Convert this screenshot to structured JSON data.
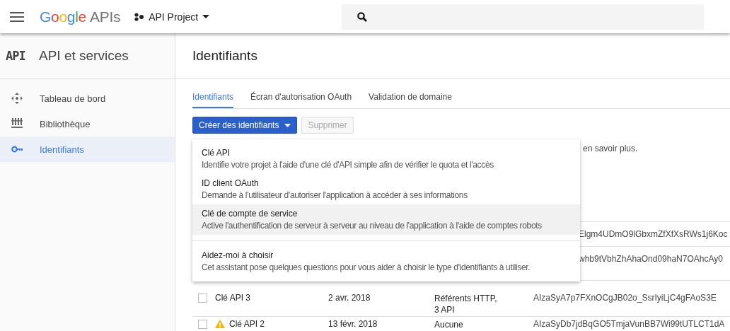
{
  "header": {
    "logo": {
      "brand": "Google",
      "product": "APIs"
    },
    "project": "API Project"
  },
  "sidebar": {
    "badge": "API",
    "title": "API et services",
    "items": [
      {
        "label": "Tableau de bord",
        "selected": false
      },
      {
        "label": "Bibliothèque",
        "selected": false
      },
      {
        "label": "Identifiants",
        "selected": true
      }
    ]
  },
  "page_title": "Identifiants",
  "tabs": [
    {
      "label": "Identifiants",
      "selected": true
    },
    {
      "label": "Écran d'autorisation OAuth",
      "selected": false
    },
    {
      "label": "Validation de domaine",
      "selected": false
    }
  ],
  "buttons": [
    {
      "label": "Créer des identifiants",
      "kind": "dropdown",
      "disabled": false
    },
    {
      "label": "Supprimer",
      "kind": "plain",
      "disabled": true
    }
  ],
  "info_text": "en savoir plus.",
  "table": {
    "rows": [
      {
        "covered": true,
        "key": "Elgm4UDmO9lGbxmZfXfXsRWs1j6Koc"
      },
      {
        "covered": true,
        "key": "whb9tVbhZhAhaOnd09haN7OAhcAy0"
      },
      {
        "covered": false,
        "checked": false,
        "warning": false,
        "name": "Clé API 3",
        "date": "2 avr. 2018",
        "restrictions": [
          "Référents HTTP,",
          "3 API"
        ],
        "key": "AIzaSyA7p7FXnOCgJB02o_SsrIyiLjC4gFAoS3E"
      },
      {
        "covered": false,
        "checked": false,
        "warning": true,
        "name": "Clé API 2",
        "date": "13 févr. 2018",
        "restrictions": [
          "Aucune"
        ],
        "key": "AIzaSyDb7jdBqGO5TmjaVunBB7Wi99tUTLCT1dA"
      }
    ]
  },
  "menu": {
    "items": [
      {
        "title": "Clé API",
        "description": "Identifie votre projet à l'aide d'une clé d'API simple afin de vérifier le quota et l'accès",
        "selected": false,
        "divider_before": false
      },
      {
        "title": "ID client OAuth",
        "description": "Demande à l'utilisateur d'autoriser l'application à accéder à ses informations",
        "selected": false,
        "divider_before": false
      },
      {
        "title": "Clé de compte de service",
        "description": "Active l'authentification de serveur à serveur au niveau de l'application à l'aide de comptes robots",
        "selected": true,
        "divider_before": false
      },
      {
        "title": "Aidez-moi à choisir",
        "description": "Cet assistant pose quelques questions pour vous aider à choisir le type d'identifiants à utiliser.",
        "selected": false,
        "divider_before": true
      }
    ]
  }
}
